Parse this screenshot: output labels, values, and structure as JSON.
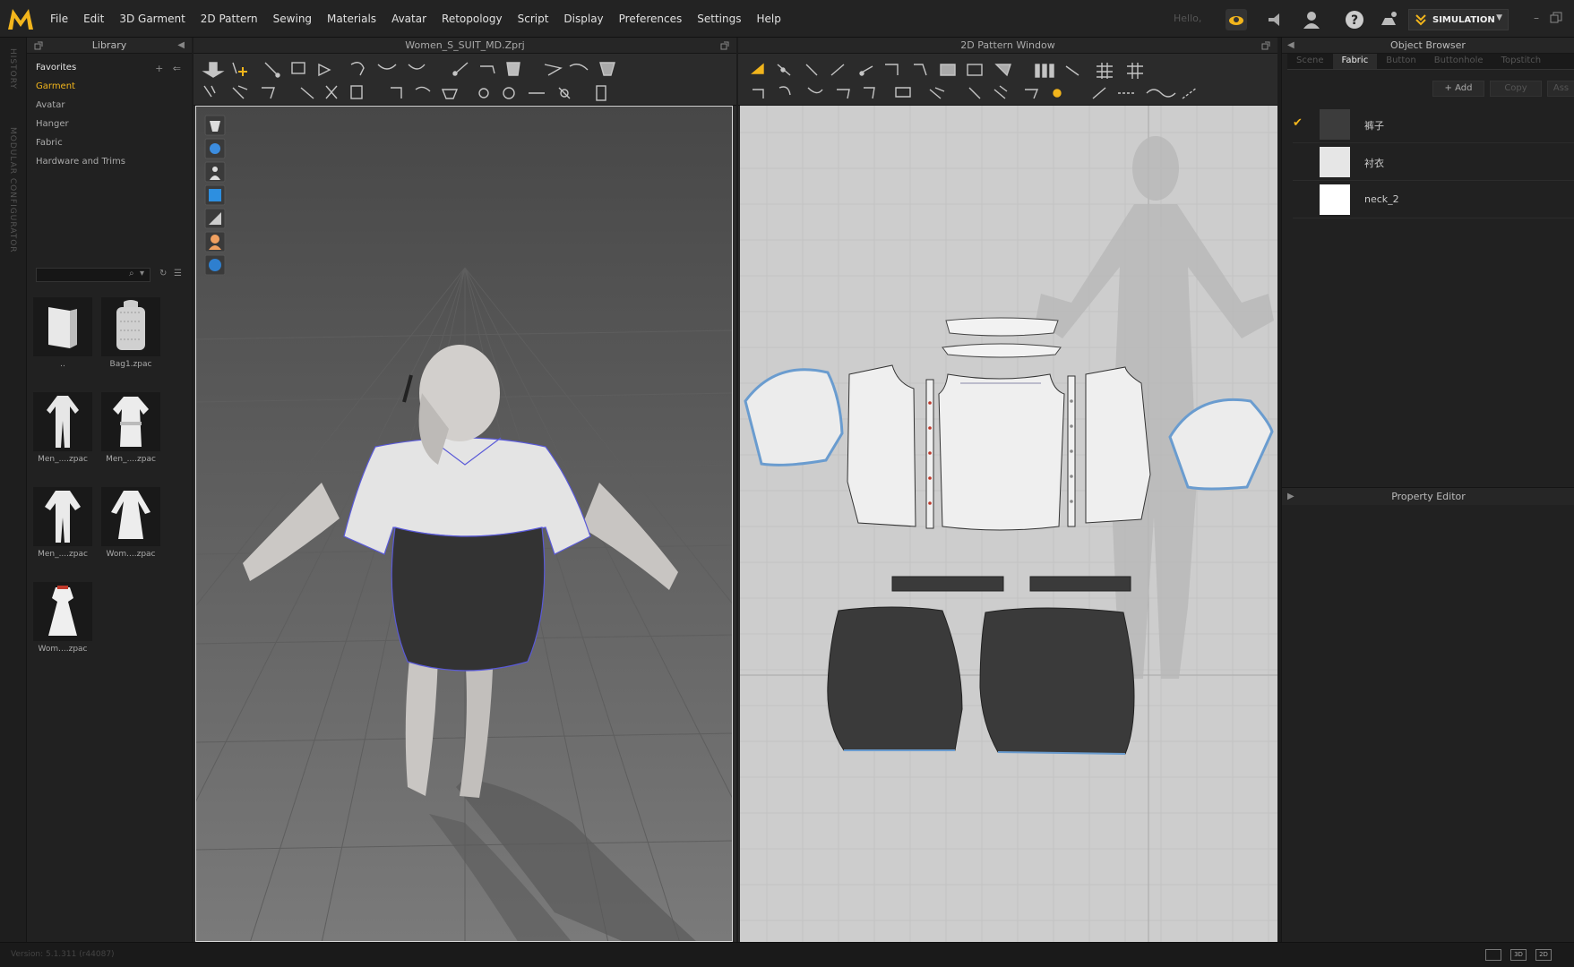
{
  "app": {
    "logo_letter": "M",
    "menu": [
      "File",
      "Edit",
      "3D Garment",
      "2D Pattern",
      "Sewing",
      "Materials",
      "Avatar",
      "Retopology",
      "Script",
      "Display",
      "Preferences",
      "Settings",
      "Help"
    ],
    "hello": "Hello,",
    "simulation_label": "SIMULATION",
    "accent": "#f2b51c"
  },
  "side_strip": {
    "history": "HISTORY",
    "modular": "MODULAR CONFIGURATOR"
  },
  "library": {
    "title": "Library",
    "favorites": "Favorites",
    "items": [
      "Garment",
      "Avatar",
      "Hanger",
      "Fabric",
      "Hardware and Trims"
    ],
    "active_item": "Garment",
    "search_placeholder": "",
    "thumbnails": [
      {
        "label": "..",
        "icon": "folder-icon"
      },
      {
        "label": "Bag1.zpac",
        "icon": "bag-icon"
      },
      {
        "label": "Men_....zpac",
        "icon": "suit-icon"
      },
      {
        "label": "Men_....zpac",
        "icon": "shirt-icon"
      },
      {
        "label": "Men_....zpac",
        "icon": "suit-icon"
      },
      {
        "label": "Wom....zpac",
        "icon": "coat-icon"
      },
      {
        "label": "Wom....zpac",
        "icon": "dress-icon"
      }
    ]
  },
  "window3d": {
    "title": "Women_S_SUIT_MD.Zprj"
  },
  "window2d": {
    "title": "2D Pattern Window"
  },
  "object_browser": {
    "title": "Object Browser",
    "tabs": [
      "Scene",
      "Fabric",
      "Button",
      "Buttonhole",
      "Topstitch"
    ],
    "active_tab": "Fabric",
    "add_label": "+ Add",
    "copy_label": "Copy",
    "assign_label": "Ass",
    "fabrics": [
      {
        "name": "裤子",
        "color": "#3c3c3c",
        "checked": true
      },
      {
        "name": "衬衣",
        "color": "#e6e6e6",
        "checked": false
      },
      {
        "name": "neck_2",
        "color": "#ffffff",
        "checked": false
      }
    ]
  },
  "property_editor": {
    "title": "Property Editor"
  },
  "status": {
    "version": "Version: 5.1.311 (r44087)",
    "view_modes": [
      "",
      "3D",
      "2D"
    ]
  }
}
